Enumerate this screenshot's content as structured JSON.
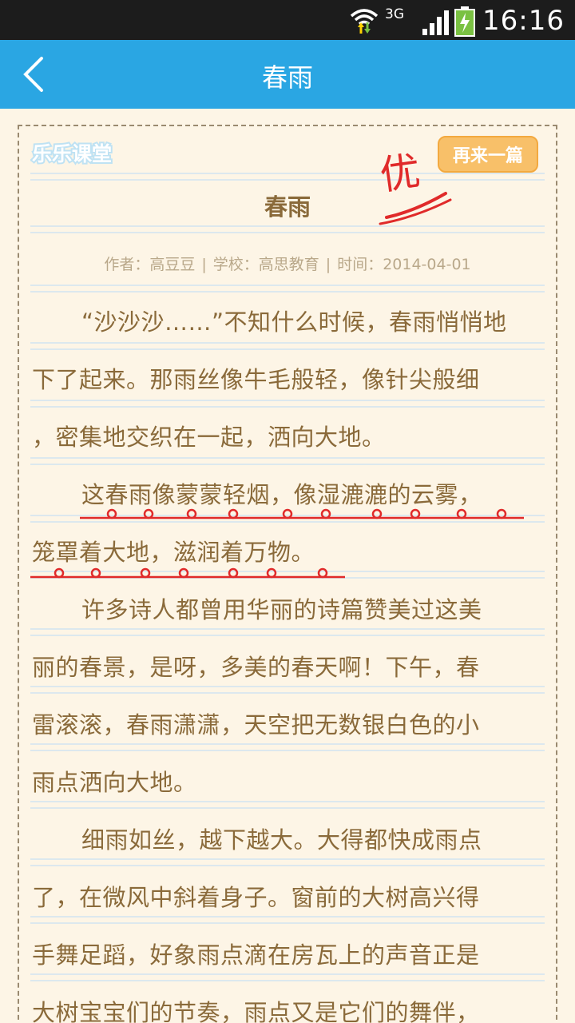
{
  "status_bar": {
    "network": "3G",
    "time": "16:16"
  },
  "header": {
    "title": "春雨",
    "back_icon": "chevron-left-icon"
  },
  "paper": {
    "logo_text": "乐乐课堂",
    "again_label": "再来一篇",
    "grade_mark": "优",
    "title": "春雨",
    "author": "作者：高豆豆",
    "school": "学校：高思教育",
    "date": "时间：2014-04-01",
    "separator": "|",
    "lines": [
      "“沙沙沙……”不知什么时候，春雨悄悄地",
      "下了起来。那雨丝像牛毛般轻，像针尖般细",
      "，密集地交织在一起，洒向大地。",
      "这春雨像蒙蒙轻烟，像湿漉漉的云雾，",
      "笼罩着大地，滋润着万物。",
      "许多诗人都曾用华丽的诗篇赞美过这美",
      "丽的春景，是呀，多美的春天啊！下午，春",
      "雷滚滚，春雨潇潇，天空把无数银白色的小",
      "雨点洒向大地。",
      "细雨如丝，越下越大。大得都快成雨点",
      "了，在微风中斜着身子。窗前的大树高兴得",
      "手舞足蹈，好象雨点滴在房瓦上的声音正是",
      "大树宝宝们的节奏，雨点又是它们的舞伴，"
    ]
  },
  "colors": {
    "header": "#2aa6e3",
    "paper": "#fdf5e6",
    "text": "#8a6a3a",
    "meta": "#b9a88a",
    "button": "#f8c069",
    "mark": "#e02a2a"
  }
}
